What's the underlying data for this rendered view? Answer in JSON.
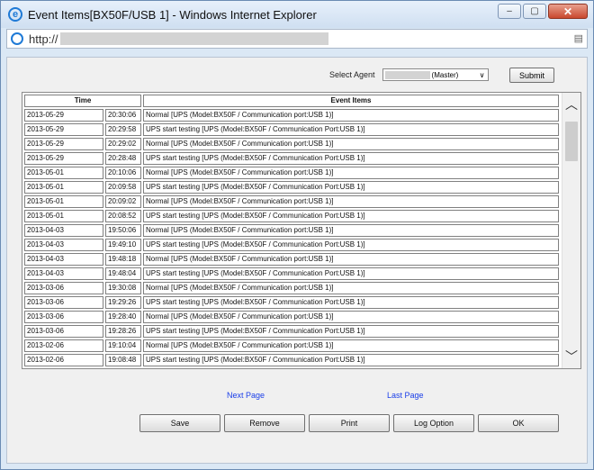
{
  "window": {
    "title": "Event Items[BX50F/USB 1] - Windows Internet Explorer",
    "minimize": "‒",
    "maximize": "▢",
    "close": "✕"
  },
  "address": {
    "url": "http://"
  },
  "agent": {
    "label": "Select Agent",
    "selected": "(Master)",
    "submit": "Submit"
  },
  "table": {
    "headers": {
      "time": "Time",
      "event": "Event Items"
    },
    "rows": [
      {
        "date": "2013-05-29",
        "time": "20:30:06",
        "event": "Normal [UPS (Model:BX50F / Communication port:USB 1)]"
      },
      {
        "date": "2013-05-29",
        "time": "20:29:58",
        "event": "UPS start testing [UPS (Model:BX50F / Communication Port:USB 1)]"
      },
      {
        "date": "2013-05-29",
        "time": "20:29:02",
        "event": "Normal [UPS (Model:BX50F / Communication port:USB 1)]"
      },
      {
        "date": "2013-05-29",
        "time": "20:28:48",
        "event": "UPS start testing [UPS (Model:BX50F / Communication Port:USB 1)]"
      },
      {
        "date": "2013-05-01",
        "time": "20:10:06",
        "event": "Normal [UPS (Model:BX50F / Communication port:USB 1)]"
      },
      {
        "date": "2013-05-01",
        "time": "20:09:58",
        "event": "UPS start testing [UPS (Model:BX50F / Communication Port:USB 1)]"
      },
      {
        "date": "2013-05-01",
        "time": "20:09:02",
        "event": "Normal [UPS (Model:BX50F / Communication port:USB 1)]"
      },
      {
        "date": "2013-05-01",
        "time": "20:08:52",
        "event": "UPS start testing [UPS (Model:BX50F / Communication Port:USB 1)]"
      },
      {
        "date": "2013-04-03",
        "time": "19:50:06",
        "event": "Normal [UPS (Model:BX50F / Communication port:USB 1)]"
      },
      {
        "date": "2013-04-03",
        "time": "19:49:10",
        "event": "UPS start testing [UPS (Model:BX50F / Communication Port:USB 1)]"
      },
      {
        "date": "2013-04-03",
        "time": "19:48:18",
        "event": "Normal [UPS (Model:BX50F / Communication port:USB 1)]"
      },
      {
        "date": "2013-04-03",
        "time": "19:48:04",
        "event": "UPS start testing [UPS (Model:BX50F / Communication Port:USB 1)]"
      },
      {
        "date": "2013-03-06",
        "time": "19:30:08",
        "event": "Normal [UPS (Model:BX50F / Communication port:USB 1)]"
      },
      {
        "date": "2013-03-06",
        "time": "19:29:26",
        "event": "UPS start testing [UPS (Model:BX50F / Communication Port:USB 1)]"
      },
      {
        "date": "2013-03-06",
        "time": "19:28:40",
        "event": "Normal [UPS (Model:BX50F / Communication port:USB 1)]"
      },
      {
        "date": "2013-03-06",
        "time": "19:28:26",
        "event": "UPS start testing [UPS (Model:BX50F / Communication Port:USB 1)]"
      },
      {
        "date": "2013-02-06",
        "time": "19:10:04",
        "event": "Normal [UPS (Model:BX50F / Communication port:USB 1)]"
      },
      {
        "date": "2013-02-06",
        "time": "19:08:48",
        "event": "UPS start testing [UPS (Model:BX50F / Communication Port:USB 1)]"
      }
    ]
  },
  "scroll": {
    "up": "︿",
    "down": "﹀"
  },
  "links": {
    "next": "Next Page",
    "last": "Last Page"
  },
  "buttons": {
    "save": "Save",
    "remove": "Remove",
    "print": "Print",
    "log_option": "Log Option",
    "ok": "OK"
  }
}
